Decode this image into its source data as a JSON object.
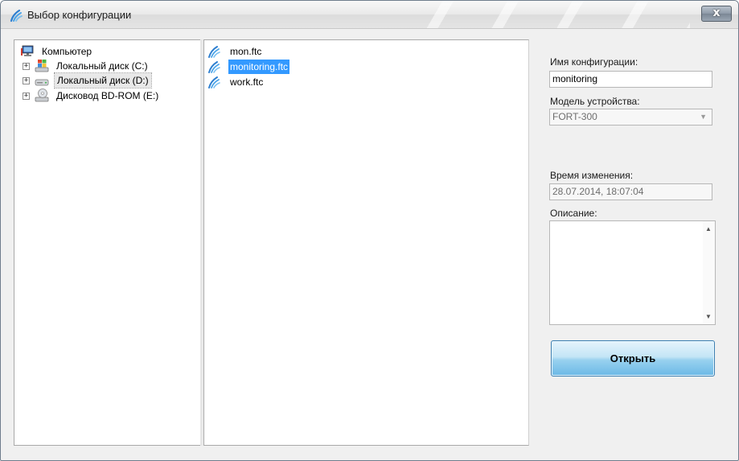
{
  "window": {
    "title": "Выбор конфигурации",
    "close_label": "x"
  },
  "tree": {
    "items": [
      {
        "label": "Компьютер",
        "icon": "computer-icon",
        "expandable": false
      },
      {
        "label": "Локальный диск (C:)",
        "icon": "windows-drive-icon",
        "expandable": true
      },
      {
        "label": "Локальный диск (D:)",
        "icon": "drive-icon",
        "expandable": true,
        "selected": true
      },
      {
        "label": "Дисковод BD-ROM (E:)",
        "icon": "optical-drive-icon",
        "expandable": true
      }
    ],
    "expander_symbol": "+"
  },
  "files": {
    "items": [
      {
        "label": "mon.ftc",
        "selected": false
      },
      {
        "label": "monitoring.ftc",
        "selected": true
      },
      {
        "label": "work.ftc",
        "selected": false
      }
    ],
    "icon": "signal-wave-icon"
  },
  "form": {
    "config_name_label": "Имя конфигурации:",
    "config_name_value": "monitoring",
    "device_model_label": "Модель устройства:",
    "device_model_value": "FORT-300",
    "modified_label": "Время изменения:",
    "modified_value": "28.07.2014, 18:07:04",
    "description_label": "Описание:",
    "description_value": "",
    "open_button": "Открыть"
  },
  "colors": {
    "selection": "#3399ff",
    "button_top": "#e5f4fc",
    "button_bottom": "#6bb9e6",
    "icon_blue": "#3a8fd6"
  }
}
